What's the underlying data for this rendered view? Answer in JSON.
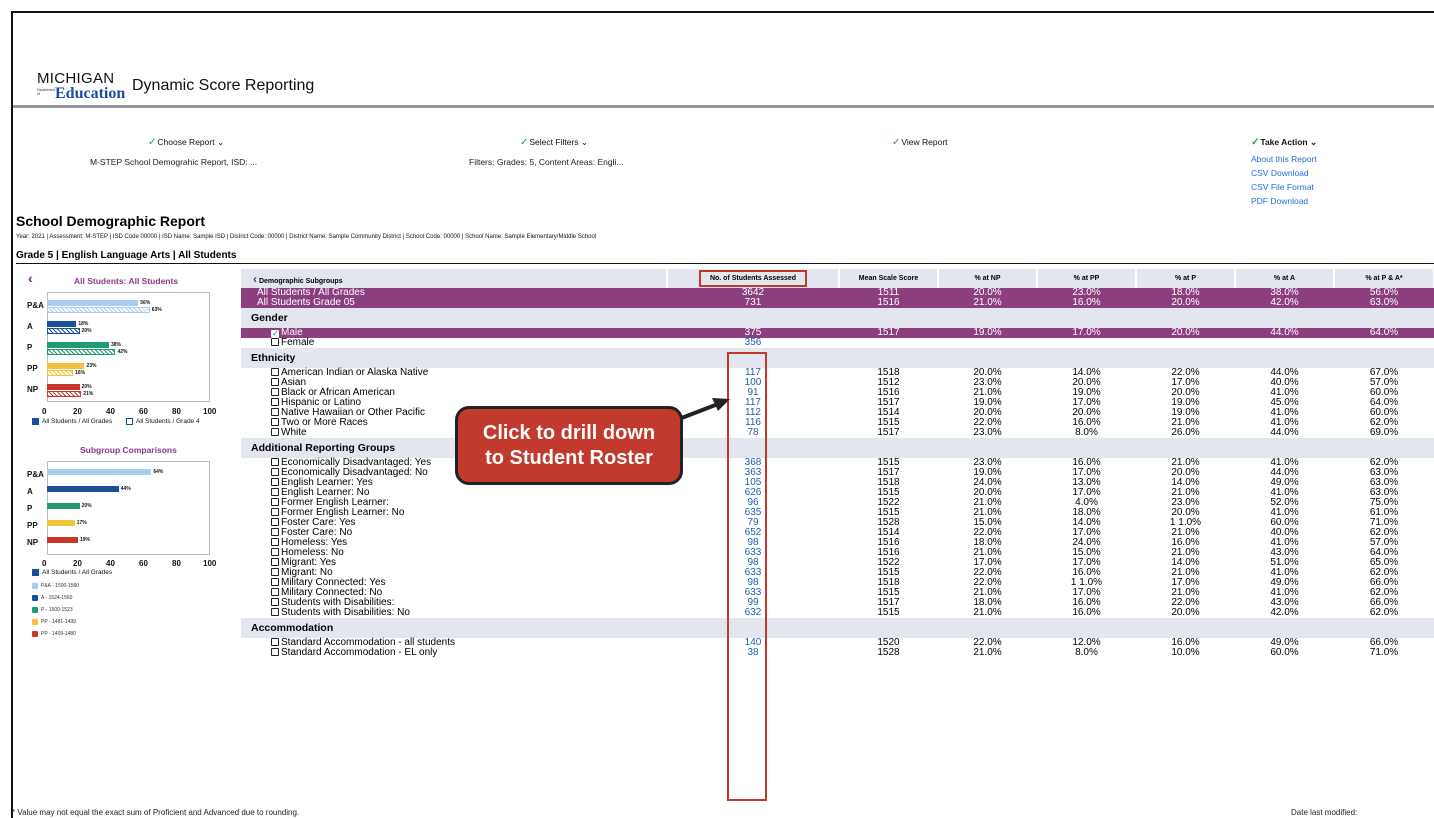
{
  "header": {
    "logo_top": "MICHIGAN",
    "logo_dept": "Department of",
    "logo_edu": "Education",
    "app_title": "Dynamic Score Reporting"
  },
  "steps": {
    "choose_report": "Choose Report",
    "choose_report_sub": "M-STEP School Demograhic Report, ISD: ...",
    "select_filters": "Select Filters",
    "select_filters_sub": "Filters: Grades: 5, Content Areas: Engli...",
    "view_report": "View Report",
    "take_action": "Take Action",
    "links": [
      "About this Report",
      "CSV Download",
      "CSV File Format",
      "PDF Download"
    ]
  },
  "report": {
    "title": "School Demographic Report",
    "meta": "Year: 2021 | Assessment: M-STEP | ISD Code 00000 | ISD Name: Sample ISD | District Code:  00000 | District Name: Sample Community District  | School Code:  00000 | School Name: Sample Elementary/Middle School",
    "grade_line": "Grade 5 | English Language Arts | All Students"
  },
  "sidebar": {
    "chart1_title": "All Students: All Students",
    "chart1_legend": [
      "All Students / All Grades",
      "All Students / Grade 4"
    ],
    "chart2_title": "Subgroup Comparisons",
    "chart2_legend": "All Students / All Grades",
    "ranges": [
      "P&A - 1500-1560",
      "A - 1524-1560",
      "P - 1500-1523",
      "PP - 1481-1499",
      "PP - 1409-1480"
    ],
    "range_colors": [
      "#a8cdf0",
      "#1a4f9c",
      "#1f9d6e",
      "#f5c33b",
      "#c9372c"
    ],
    "axis_ticks": [
      "0",
      "20",
      "40",
      "60",
      "80",
      "100"
    ]
  },
  "chart_data": [
    {
      "type": "bar",
      "title": "All Students: All Students",
      "categories": [
        "P&A",
        "A",
        "P",
        "PP",
        "NP"
      ],
      "series": [
        {
          "name": "All Students / All Grades",
          "values": [
            56,
            18,
            38,
            23,
            20
          ]
        },
        {
          "name": "All Students / Grade 4",
          "values": [
            63,
            20,
            42,
            16,
            21
          ]
        }
      ],
      "xlim": [
        0,
        100
      ]
    },
    {
      "type": "bar",
      "title": "Subgroup Comparisons",
      "categories": [
        "P&A",
        "A",
        "P",
        "PP",
        "NP"
      ],
      "series": [
        {
          "name": "All Students / All Grades",
          "values": [
            64,
            44,
            20,
            17,
            19
          ]
        }
      ],
      "xlim": [
        0,
        100
      ]
    }
  ],
  "table": {
    "back_label": "Demographic Subgroups",
    "columns": [
      "No. of Students Assessed",
      "Mean Scale Score",
      "% at NP",
      "% at PP",
      "% at P",
      "% at A",
      "% at P & A*"
    ],
    "top_rows": [
      {
        "name": "All Students / All Grades",
        "vals": [
          "3642",
          "1511",
          "20.0%",
          "23.0%",
          "18.0%",
          "38.0%",
          "56.0%"
        ]
      },
      {
        "name": "All Students Grade 05",
        "vals": [
          "731",
          "1516",
          "21.0%",
          "16.0%",
          "20.0%",
          "42.0%",
          "63.0%"
        ]
      }
    ],
    "sections": [
      {
        "title": "Gender",
        "rows": [
          {
            "name": "Male",
            "checked": true,
            "vals": [
              "375",
              "1517",
              "19.0%",
              "17.0%",
              "20.0%",
              "44.0%",
              "64.0%"
            ]
          },
          {
            "name": "Female",
            "checked": false,
            "vals": [
              "356",
              "",
              "",
              "",
              "",
              "",
              ""
            ]
          }
        ]
      },
      {
        "title": "Ethnicity",
        "rows": [
          {
            "name": "American Indian or Alaska Native",
            "vals": [
              "117",
              "1518",
              "20.0%",
              "14.0%",
              "22.0%",
              "44.0%",
              "67.0%"
            ]
          },
          {
            "name": "Asian",
            "vals": [
              "100",
              "1512",
              "23.0%",
              "20.0%",
              "17.0%",
              "40.0%",
              "57.0%"
            ]
          },
          {
            "name": "Black or African American",
            "vals": [
              "91",
              "1516",
              "21.0%",
              "19.0%",
              "20.0%",
              "41.0%",
              "60.0%"
            ]
          },
          {
            "name": "Hispanic or Latino",
            "vals": [
              "117",
              "1517",
              "19.0%",
              "17.0%",
              "19.0%",
              "45.0%",
              "64.0%"
            ]
          },
          {
            "name": "Native Hawaiian or Other Pacific",
            "vals": [
              "112",
              "1514",
              "20.0%",
              "20.0%",
              "19.0%",
              "41.0%",
              "60.0%"
            ]
          },
          {
            "name": "Two or More Races",
            "vals": [
              "116",
              "1515",
              "22.0%",
              "16.0%",
              "21.0%",
              "41.0%",
              "62.0%"
            ]
          },
          {
            "name": "White",
            "vals": [
              "78",
              "1517",
              "23.0%",
              "8.0%",
              "26.0%",
              "44.0%",
              "69.0%"
            ]
          }
        ]
      },
      {
        "title": "Additional Reporting Groups",
        "rows": [
          {
            "name": "Economically Disadvantaged: Yes",
            "vals": [
              "368",
              "1515",
              "23.0%",
              "16.0%",
              "21.0%",
              "41.0%",
              "62.0%"
            ]
          },
          {
            "name": "Economically Disadvantaged: No",
            "vals": [
              "363",
              "1517",
              "19.0%",
              "17.0%",
              "20.0%",
              "44.0%",
              "63.0%"
            ]
          },
          {
            "name": "English Learner:  Yes",
            "vals": [
              "105",
              "1518",
              "24.0%",
              "13.0%",
              "14.0%",
              "49.0%",
              "63.0%"
            ]
          },
          {
            "name": "English Learner: No",
            "vals": [
              "626",
              "1515",
              "20.0%",
              "17.0%",
              "21.0%",
              "41.0%",
              "63.0%"
            ]
          },
          {
            "name": "Former English Learner:",
            "vals": [
              "96",
              "1522",
              "21.0%",
              "4.0%",
              "23.0%",
              "52.0%",
              "75.0%"
            ]
          },
          {
            "name": "Former English Learner: No",
            "vals": [
              "635",
              "1515",
              "21.0%",
              "18.0%",
              "20.0%",
              "41.0%",
              "61.0%"
            ]
          },
          {
            "name": "Foster Care:  Yes",
            "vals": [
              "79",
              "1528",
              "15.0%",
              "14.0%",
              "1 1.0%",
              "60.0%",
              "71.0%"
            ]
          },
          {
            "name": "Foster Care: No",
            "vals": [
              "652",
              "1514",
              "22.0%",
              "17.0%",
              "21.0%",
              "40.0%",
              "62.0%"
            ]
          },
          {
            "name": "Homeless:  Yes",
            "vals": [
              "98",
              "1516",
              "18.0%",
              "24.0%",
              "16.0%",
              "41.0%",
              "57.0%"
            ]
          },
          {
            "name": "Homeless: No",
            "vals": [
              "633",
              "1516",
              "21.0%",
              "15.0%",
              "21.0%",
              "43.0%",
              "64.0%"
            ]
          },
          {
            "name": "Migrant:  Yes",
            "vals": [
              "98",
              "1522",
              "17.0%",
              "17.0%",
              "14.0%",
              "51.0%",
              "65.0%"
            ]
          },
          {
            "name": "Migrant: No",
            "vals": [
              "633",
              "1515",
              "22.0%",
              "16.0%",
              "21.0%",
              "41.0%",
              "62.0%"
            ]
          },
          {
            "name": "Military Connected:  Yes",
            "vals": [
              "98",
              "1518",
              "22.0%",
              "1 1.0%",
              "17.0%",
              "49.0%",
              "66.0%"
            ]
          },
          {
            "name": "Military Connected: No",
            "vals": [
              "633",
              "1515",
              "21.0%",
              "17.0%",
              "21.0%",
              "41.0%",
              "62.0%"
            ]
          },
          {
            "name": "Students with Disabilities:",
            "vals": [
              "99",
              "1517",
              "18.0%",
              "16.0%",
              "22.0%",
              "43.0%",
              "66.0%"
            ]
          },
          {
            "name": "Students with Disabilities: No",
            "vals": [
              "632",
              "1515",
              "21.0%",
              "16.0%",
              "20.0%",
              "42.0%",
              "62.0%"
            ]
          }
        ]
      },
      {
        "title": "Accommodation",
        "rows": [
          {
            "name": "Standard  Accommodation - all students",
            "vals": [
              "140",
              "1520",
              "22.0%",
              "12.0%",
              "16.0%",
              "49.0%",
              "66.0%"
            ]
          },
          {
            "name": "Standard  Accommodation - EL only",
            "vals": [
              "38",
              "1528",
              "21.0%",
              "8.0%",
              "10.0%",
              "60.0%",
              "71.0%"
            ]
          }
        ]
      }
    ]
  },
  "callout": {
    "line1": "Click to drill down",
    "line2": "to Student Roster"
  },
  "footer": {
    "note": "* Value may not equal the exact sum of Proficient and Advanced due to rounding.",
    "modified": "Date last modified:"
  }
}
